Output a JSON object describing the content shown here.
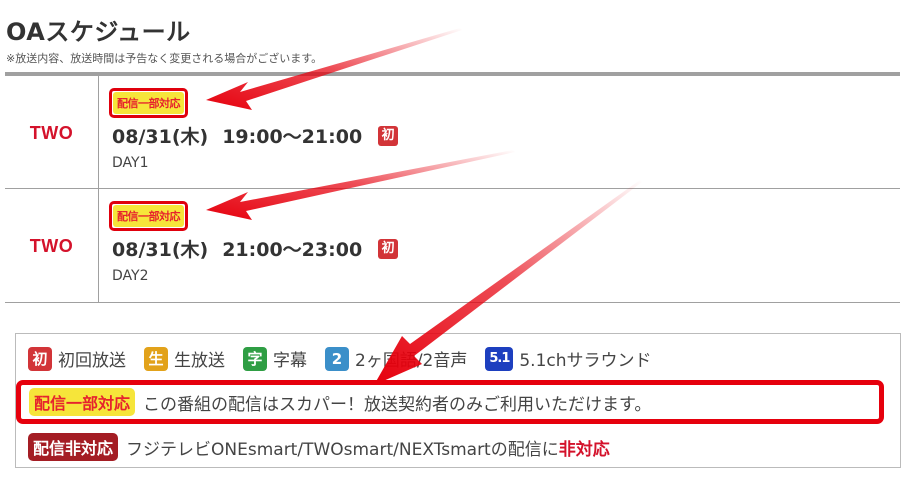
{
  "page": {
    "title": "OAスケジュール",
    "notice": "※放送内容、放送時間は予告なく変更される場合がございます。"
  },
  "schedule": [
    {
      "channel": "TWO",
      "tag": "配信一部対応",
      "date": "08/31(木)",
      "time": "19:00〜21:00",
      "mark": "初",
      "program": "DAY1"
    },
    {
      "channel": "TWO",
      "tag": "配信一部対応",
      "date": "08/31(木)",
      "time": "21:00〜23:00",
      "mark": "初",
      "program": "DAY2"
    }
  ],
  "legend": {
    "icons": [
      {
        "glyph": "初",
        "label": "初回放送",
        "color": "#d23438"
      },
      {
        "glyph": "生",
        "label": "生放送",
        "color": "#e2a21a"
      },
      {
        "glyph": "字",
        "label": "字幕",
        "color": "#2f9e44"
      },
      {
        "glyph": "2",
        "label": "2ヶ国語/2音声",
        "color": "#3b8fc9"
      },
      {
        "glyph": "5.1",
        "label": "5.1chサラウンド",
        "color": "#1d3fbf"
      }
    ],
    "partial": {
      "tag": "配信一部対応",
      "text": "この番組の配信はスカパー！放送契約者のみご利用いただけます。"
    },
    "unsupported": {
      "tag": "配信非対応",
      "text": "フジテレビONEsmart/TWOsmart/NEXTsmartの配信に",
      "emphasis": "非対応"
    }
  },
  "colors": {
    "accent_red": "#e6000d",
    "tag_yellow": "#f6e53a",
    "channel_red": "#d4122b"
  }
}
